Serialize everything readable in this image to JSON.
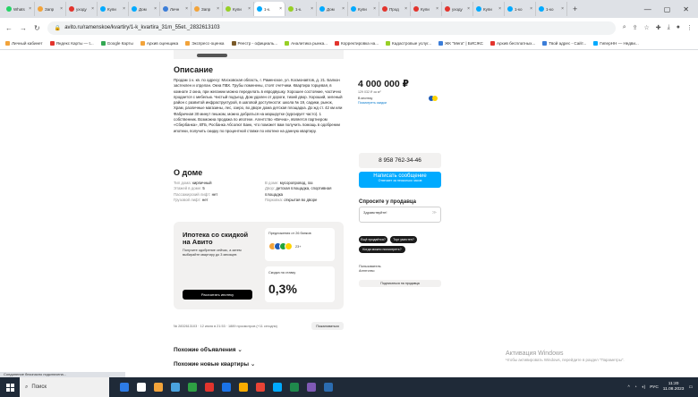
{
  "browser": {
    "tabs": [
      {
        "label": "Whats",
        "color": "#25d366"
      },
      {
        "label": "Запр",
        "color": "#f2a33a"
      },
      {
        "label": "уходу",
        "color": "#e2342d"
      },
      {
        "label": "Купи",
        "color": "#00aaff"
      },
      {
        "label": "Дом",
        "color": "#00aaff"
      },
      {
        "label": "Личн",
        "color": "#3b7dd8"
      },
      {
        "label": "Запр",
        "color": "#f2a33a"
      },
      {
        "label": "Купи",
        "color": "#97cf26"
      },
      {
        "label": "1-к.",
        "color": "#00aaff",
        "active": true
      },
      {
        "label": "1-к.",
        "color": "#97cf26"
      },
      {
        "label": "Дом",
        "color": "#00aaff"
      },
      {
        "label": "Купи",
        "color": "#00aaff"
      },
      {
        "label": "Прод",
        "color": "#e2342d"
      },
      {
        "label": "Купи",
        "color": "#e2342d"
      },
      {
        "label": "уходу",
        "color": "#e2342d"
      },
      {
        "label": "Купи",
        "color": "#00aaff"
      },
      {
        "label": "1-ко",
        "color": "#00aaff"
      },
      {
        "label": "1-ко",
        "color": "#00aaff"
      }
    ],
    "new_tab": "+",
    "url": "avito.ru/ramenskoe/kvartiry/1-k_kvartira_31m_55et._2832613103",
    "bookmarks": [
      {
        "label": "Личный кабинет",
        "color": "#f2a33a"
      },
      {
        "label": "Яндекс Карты — t...",
        "color": "#e2342d"
      },
      {
        "label": "Google Карты",
        "color": "#34a853"
      },
      {
        "label": "Архив оценщика",
        "color": "#f2a33a"
      },
      {
        "label": "Экспресс-оценка",
        "color": "#f2a33a"
      },
      {
        "label": "Реестр - официаль...",
        "color": "#7a5a2a"
      },
      {
        "label": "Аналитика рынка...",
        "color": "#97cf26"
      },
      {
        "label": "Корректировка на...",
        "color": "#e2342d"
      },
      {
        "label": "Кадастровые услуг...",
        "color": "#97cf26"
      },
      {
        "label": "ЖК \"Мега\" | БИСЖС",
        "color": "#3b7dd8"
      },
      {
        "label": "Архив бесплатных...",
        "color": "#e2342d"
      },
      {
        "label": "Твой адрес - Сайт...",
        "color": "#3b7dd8"
      },
      {
        "label": "ГиперНН — Недви...",
        "color": "#00aaff"
      }
    ]
  },
  "listing": {
    "description_title": "Описание",
    "description_text": "Продам 1 к. кв. по адресу: Московская область, г. Раменское, ул. Космонавтов, д. 21. Балкон застеклен и отделан. Окна ПВХ. Трубы поменены, стоят счетчики. Квартира торцевая, в комнате 2 окна, при желании можно переделать в евродвушку. Хорошее состояние, частично продается с мебелью. Чистый подъезд. Дом удален от дороги, тихий двор. Хороший, зеленый район с развитой инфраструктурой, в шаговой доступности: школа № 19, садики, рынок, Храм, различные магазины, лес, озеро, во дворе дома детская площадка. До жд ст. 42 км или Фабричная 30 минут пешком, можно добраться на маршрутке (курсирует часто). 1 собственник. Возможна продажа по ипотеке. Агентство «Вечна», является партнером «Сбербанка», ВТБ, Росбанка Абсолют Банк, что поможет вам получить помощь в одобрении ипотеки, получить скидку по процентной ставке по ипотеке на данную квартиру.",
    "house_title": "О доме",
    "house_props_left": [
      {
        "k": "Тип дома:",
        "v": "кирпичный"
      },
      {
        "k": "Этажей в доме:",
        "v": "5"
      },
      {
        "k": "Пассажирский лифт:",
        "v": "нет"
      },
      {
        "k": "Грузовой лифт:",
        "v": "нет"
      }
    ],
    "house_props_right": [
      {
        "k": "В доме:",
        "v": "мусоропровод, газ"
      },
      {
        "k": "Двор:",
        "v": "детская площадка, спортивная площадка"
      },
      {
        "k": "Парковка:",
        "v": "открытая во дворе"
      }
    ],
    "mortgage": {
      "title": "Ипотека со скидкой на Авито",
      "subtitle": "Получите одобрение сейчас, а затем выбирайте квартиру до 3 месяцев",
      "button": "Рассчитать ипотеку",
      "offers_label": "Предложения от 26 банков",
      "banks": [
        "#f2a33a",
        "#1e5bb8",
        "#1fa33a",
        "#ffd400"
      ],
      "banks_more": "23+",
      "rate_label": "Скидка на ставку",
      "rate_value": "0,3%"
    },
    "meta": "№ 2832613103 · 12 июля в 21:53 · 1889 просмотров (+11 сегодня)",
    "complain": "Пожаловаться",
    "similar": "Похожие объявления ⌄",
    "similar_new": "Похожие новые квартиры ⌄"
  },
  "sidebar": {
    "price": "4 000 000 ₽",
    "price_sqm": "129 032 ₽ за м²",
    "mortgage_line": "В ипотеку",
    "mortgage_link": "Посмотреть скидки",
    "phone": "8 958 762-34-46",
    "message_button": "Написать сообщение",
    "message_sub": "Отвечает за несколько часов",
    "ask_title": "Спросите у продавца",
    "ask_placeholder": "Здравствуйте!",
    "chips": [
      "Ещё продаётся?",
      "Торг уместен?",
      "Когда можно посмотреть?"
    ],
    "seller_type": "Пользователь",
    "seller_name": "Агентство",
    "subscribe": "Подписаться на продавца"
  },
  "status_hint": "Соединение безопасно подключена...",
  "watermark": {
    "line1": "Активация Windows",
    "line2": "Чтобы активировать Windows, перейдите в раздел \"Параметры\"."
  },
  "taskbar": {
    "search_placeholder": "Поиск",
    "apps": [
      "#2d7be5",
      "#ffffff",
      "#f2a33a",
      "#4aa3df",
      "#2ea043",
      "#e2342d",
      "#1a73e8",
      "#f9ab00",
      "#ea4335",
      "#00aaff",
      "#1f8a4c",
      "#7f5ab5",
      "#2b6cb0"
    ],
    "lang": "РУС",
    "time": "11:20",
    "date": "11.08.2023"
  }
}
